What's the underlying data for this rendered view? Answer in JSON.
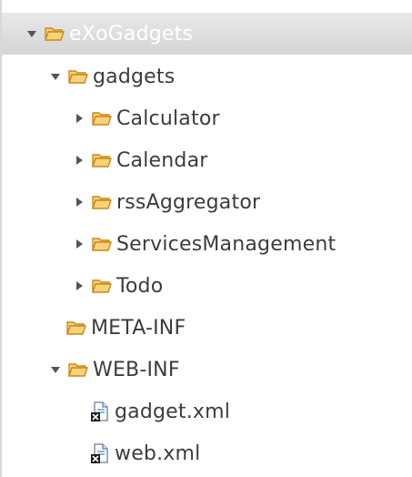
{
  "tree": {
    "root": {
      "label": "eXoGadgets",
      "expanded": true,
      "selected": true,
      "icon": "folder-icon"
    },
    "gadgets": {
      "label": "gadgets",
      "expanded": true,
      "icon": "folder-icon"
    },
    "gadget_children": [
      {
        "label": "Calculator",
        "expanded": false,
        "icon": "folder-icon"
      },
      {
        "label": "Calendar",
        "expanded": false,
        "icon": "folder-icon"
      },
      {
        "label": "rssAggregator",
        "expanded": false,
        "icon": "folder-icon"
      },
      {
        "label": "ServicesManagement",
        "expanded": false,
        "icon": "folder-icon"
      },
      {
        "label": "Todo",
        "expanded": false,
        "icon": "folder-icon"
      }
    ],
    "meta_inf": {
      "label": "META-INF",
      "icon": "folder-icon"
    },
    "web_inf": {
      "label": "WEB-INF",
      "expanded": true,
      "icon": "folder-icon"
    },
    "web_inf_children": [
      {
        "label": "gadget.xml",
        "icon": "xml-file-icon"
      },
      {
        "label": "web.xml",
        "icon": "xml-file-icon"
      }
    ]
  },
  "colors": {
    "folder_fill": "#f6d27a",
    "folder_stroke": "#c98a1a",
    "text": "#3c3c3c",
    "selection": "#dcdcdc"
  }
}
